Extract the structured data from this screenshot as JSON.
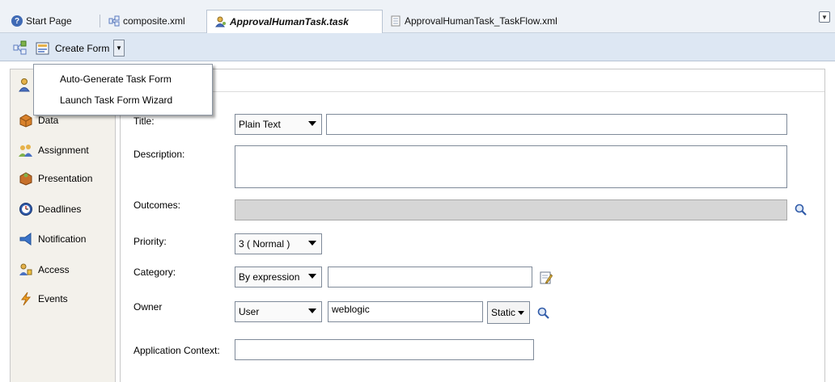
{
  "tabs": [
    {
      "label": "Start Page"
    },
    {
      "label": "composite.xml"
    },
    {
      "label": "ApprovalHumanTask.task"
    },
    {
      "label": "ApprovalHumanTask_TaskFlow.xml"
    }
  ],
  "toolbar": {
    "create_form_label": "Create Form"
  },
  "menu": {
    "items": [
      "Auto-Generate Task Form",
      "Launch Task Form Wizard"
    ]
  },
  "nav": {
    "items": [
      "Data",
      "Assignment",
      "Presentation",
      "Deadlines",
      "Notification",
      "Access",
      "Events"
    ]
  },
  "form": {
    "title": {
      "label": "Title:",
      "type_value": "Plain Text",
      "value": ""
    },
    "description": {
      "label": "Description:",
      "value": ""
    },
    "outcomes": {
      "label": "Outcomes:",
      "value": ""
    },
    "priority": {
      "label": "Priority:",
      "value": "3  ( Normal )"
    },
    "category": {
      "label": "Category:",
      "type_value": "By expression",
      "value": ""
    },
    "owner": {
      "label": "Owner",
      "type_value": "User",
      "value": "weblogic",
      "mode_value": "Static"
    },
    "application_context": {
      "label": "Application Context:",
      "value": ""
    }
  },
  "colors": {
    "accent": "#3f6ab5",
    "toolbar_bg": "#dde7f3",
    "nav_bg": "#f3f1eb",
    "disabled_field": "#d6d6d6"
  }
}
